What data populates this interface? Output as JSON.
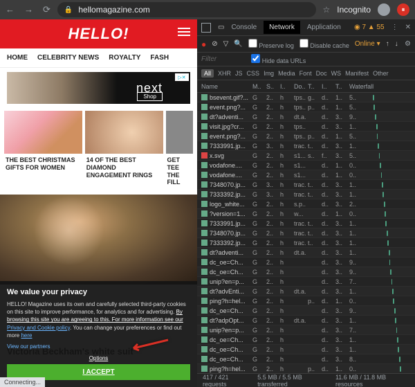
{
  "browser": {
    "url": "hellomagazine.com",
    "incognito": "Incognito",
    "status": "Connecting..."
  },
  "page": {
    "logo": "HELLO!",
    "nav": [
      "HOME",
      "CELEBRITY NEWS",
      "ROYALTY",
      "FASH"
    ],
    "ad": {
      "brand": "next",
      "cta": "Shop",
      "badge": "▷✕"
    },
    "cards": [
      {
        "title": "THE BEST CHRISTMAS GIFTS FOR WOMEN"
      },
      {
        "title": "14 OF THE BEST DIAMOND ENGAGEMENT RINGS"
      },
      {
        "title": "GET TEE THE FILL"
      }
    ],
    "consent": {
      "heading": "We value your privacy",
      "body1": "HELLO! Magazine uses its own and carefully selected third-party cookies on this site to improve performance, for analytics and for advertising.",
      "body2_under": "By browsing this site you are agreeing to this. For more information see our",
      "policy": "Privacy and Cookie policy",
      "body3": ". You can change your preferences or find out more",
      "here": "here",
      "partners": "View our partners",
      "options": "Options",
      "accept": "I ACCEPT"
    },
    "behind_title": "Victoria Beckham's white suit"
  },
  "devtools": {
    "tabs": [
      "Console",
      "Network",
      "Application"
    ],
    "warn_count": "7",
    "warn_other": "55",
    "preserve": "Preserve log",
    "disable": "Disable cache",
    "online": "Online",
    "filter_ph": "Filter",
    "hide": "Hide data URLs",
    "filters": [
      "All",
      "XHR",
      "JS",
      "CSS",
      "Img",
      "Media",
      "Font",
      "Doc",
      "WS",
      "Manifest",
      "Other"
    ],
    "columns": [
      "Name",
      "M..",
      "S..",
      "I..",
      "Do..",
      "T..",
      "I..",
      "T..",
      "Waterfall"
    ],
    "requests": [
      {
        "n": "bsevent.gif?...",
        "c": [
          "G",
          "2..",
          "h",
          "tps..",
          "g..",
          "d..",
          "1..",
          "5.."
        ],
        "x": 20,
        "w": 3
      },
      {
        "n": "event.png?...",
        "c": [
          "G",
          "2..",
          "h",
          "tps..",
          "p..",
          "d..",
          "1..",
          "5.."
        ],
        "x": 22,
        "w": 3
      },
      {
        "n": "dt?adventi...",
        "c": [
          "G",
          "2..",
          "h",
          "dt.a..",
          "",
          "d..",
          "3..",
          "9.."
        ],
        "x": 25,
        "w": 2
      },
      {
        "n": "visit.jpg?cr...",
        "c": [
          "G",
          "2..",
          "h",
          "tps..",
          "",
          "d..",
          "3..",
          "1.."
        ],
        "x": 27,
        "w": 3
      },
      {
        "n": "event.png?...",
        "c": [
          "G",
          "2..",
          "h",
          "tps..",
          "p..",
          "d..",
          "1..",
          "5.."
        ],
        "x": 29,
        "w": 2
      },
      {
        "n": "7333991.jp...",
        "c": [
          "G",
          "3..",
          "h",
          "trac..",
          "t..",
          "d..",
          "3..",
          "1.."
        ],
        "x": 31,
        "w": 3
      },
      {
        "n": "x.svg",
        "c": [
          "G",
          "2..",
          "h",
          "s1...",
          "s..",
          "f..",
          "3..",
          "5.."
        ],
        "x": 33,
        "w": 2,
        "svg": true
      },
      {
        "n": "vodafone....",
        "c": [
          "G",
          "2..",
          "h",
          "s1...",
          "",
          "d..",
          "1..",
          "0.."
        ],
        "x": 35,
        "w": 3
      },
      {
        "n": "vodafone....",
        "c": [
          "G",
          "2..",
          "h",
          "s1...",
          "",
          "d..",
          "1..",
          "0.."
        ],
        "x": 37,
        "w": 2
      },
      {
        "n": "7348070.jp...",
        "c": [
          "G",
          "3..",
          "h",
          "trac..",
          "t..",
          "d..",
          "3..",
          "1.."
        ],
        "x": 39,
        "w": 3
      },
      {
        "n": "7333392.jp...",
        "c": [
          "G",
          "3..",
          "h",
          "trac..",
          "t..",
          "d..",
          "3..",
          "1.."
        ],
        "x": 41,
        "w": 2
      },
      {
        "n": "logo_white...",
        "c": [
          "G",
          "2..",
          "h",
          "s.p..",
          "",
          "d..",
          "3..",
          "2.."
        ],
        "x": 43,
        "w": 3
      },
      {
        "n": "?version=1...",
        "c": [
          "G",
          "2..",
          "h",
          "w...",
          "",
          "d..",
          "1..",
          "0.."
        ],
        "x": 45,
        "w": 3
      },
      {
        "n": "7333991.jp...",
        "c": [
          "G",
          "2..",
          "h",
          "trac..",
          "t..",
          "d..",
          "3..",
          "1.."
        ],
        "x": 47,
        "w": 2
      },
      {
        "n": "7348070.jp...",
        "c": [
          "G",
          "2..",
          "h",
          "trac..",
          "t..",
          "d..",
          "3..",
          "1.."
        ],
        "x": 49,
        "w": 3
      },
      {
        "n": "7333392.jp...",
        "c": [
          "G",
          "2..",
          "h",
          "trac..",
          "t..",
          "d..",
          "3..",
          "1.."
        ],
        "x": 51,
        "w": 2
      },
      {
        "n": "dt?adventi...",
        "c": [
          "G",
          "2..",
          "h",
          "dt.a..",
          "",
          "d..",
          "3..",
          "1.."
        ],
        "x": 53,
        "w": 3
      },
      {
        "n": "dc_oe=Ch...",
        "c": [
          "G",
          "2..",
          "h",
          "",
          "",
          "d..",
          "3..",
          "9.."
        ],
        "x": 55,
        "w": 2
      },
      {
        "n": "dc_oe=Ch...",
        "c": [
          "G",
          "2..",
          "h",
          "",
          "",
          "d..",
          "3..",
          "9.."
        ],
        "x": 57,
        "w": 3
      },
      {
        "n": "unip?en=p...",
        "c": [
          "G",
          "2..",
          "h",
          "",
          "",
          "d..",
          "3..",
          "7.."
        ],
        "x": 59,
        "w": 2
      },
      {
        "n": "dt?advEnti...",
        "c": [
          "G",
          "2..",
          "h",
          "dt.a..",
          "",
          "d..",
          "3..",
          "1.."
        ],
        "x": 61,
        "w": 3
      },
      {
        "n": "ping?h=hel...",
        "c": [
          "G",
          "2..",
          "h",
          "",
          "p..",
          "d..",
          "1..",
          "0.."
        ],
        "x": 63,
        "w": 2
      },
      {
        "n": "dc_oe=Ch...",
        "c": [
          "G",
          "2..",
          "h",
          "",
          "",
          "d..",
          "3..",
          "9.."
        ],
        "x": 65,
        "w": 3
      },
      {
        "n": "dt?adpOpt...",
        "c": [
          "G",
          "2..",
          "h",
          "dt.a..",
          "",
          "d..",
          "3..",
          "1.."
        ],
        "x": 67,
        "w": 3
      },
      {
        "n": "unip?en=p...",
        "c": [
          "G",
          "2..",
          "h",
          "",
          "",
          "d..",
          "3..",
          "7.."
        ],
        "x": 69,
        "w": 2
      },
      {
        "n": "dc_oe=Ch...",
        "c": [
          "G",
          "2..",
          "h",
          "",
          "",
          "d..",
          "3..",
          "1.."
        ],
        "x": 71,
        "w": 3
      },
      {
        "n": "dc_oe=Ch...",
        "c": [
          "G",
          "2..",
          "h",
          "",
          "",
          "d..",
          "3..",
          "1.."
        ],
        "x": 73,
        "w": 2
      },
      {
        "n": "dc_oe=Ch...",
        "c": [
          "G",
          "2..",
          "h",
          "",
          "",
          "d..",
          "3..",
          "8.."
        ],
        "x": 75,
        "w": 3
      },
      {
        "n": "ping?h=hel...",
        "c": [
          "G",
          "2..",
          "h",
          "",
          "p..",
          "d..",
          "1..",
          "0.."
        ],
        "x": 77,
        "w": 3
      }
    ],
    "status": {
      "requests": "417 / 421 requests",
      "transferred": "5.5 MB / 5.5 MB transferred",
      "resources": "11.6 MB / 11.8 MB resources"
    }
  }
}
